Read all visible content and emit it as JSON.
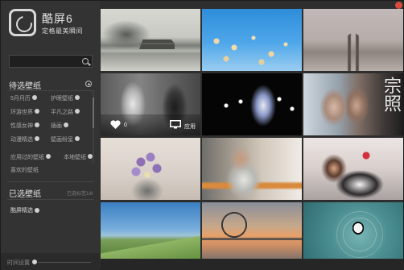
{
  "brand": {
    "name": "酷屏6",
    "slogan": "定格最美瞬间"
  },
  "search": {
    "value": "",
    "placeholder": ""
  },
  "pending": {
    "title": "待选壁纸",
    "categories": [
      {
        "label": "5月月历"
      },
      {
        "label": "护眼壁纸"
      },
      {
        "label": "环游世界"
      },
      {
        "label": "平凡之路"
      },
      {
        "label": "性感女神"
      },
      {
        "label": "插画"
      },
      {
        "label": "动漫精选"
      },
      {
        "label": "壁画纷呈"
      }
    ],
    "extra": [
      {
        "label": "应用过的壁纸"
      },
      {
        "label": "本地壁纸"
      },
      {
        "label": "喜欢的壁纸"
      }
    ]
  },
  "chosen": {
    "title": "已选壁纸",
    "hint": "已选标签1/8",
    "items": [
      {
        "label": "酷屏精选"
      }
    ]
  },
  "bottom": {
    "label": "时间设置",
    "slider_level": 0
  },
  "wallpaper_overlay": {
    "like_count": "0",
    "apply_label": "应用"
  },
  "thumbnails": [
    {
      "name": "lake-pavilion"
    },
    {
      "name": "reeds-blue-sky"
    },
    {
      "name": "railway-track"
    },
    {
      "name": "couple-bw"
    },
    {
      "name": "anime-dark"
    },
    {
      "name": "couple-closeup"
    },
    {
      "name": "lavender-flowers"
    },
    {
      "name": "man-in-cafe"
    },
    {
      "name": "girl-maid"
    },
    {
      "name": "green-hills"
    },
    {
      "name": "ferris-wheel-sunset"
    },
    {
      "name": "panda-water"
    }
  ],
  "calligraphy_text": "宗照",
  "colors": {
    "sidebar_bg": "#333333",
    "close_button": "#d94a3d"
  }
}
